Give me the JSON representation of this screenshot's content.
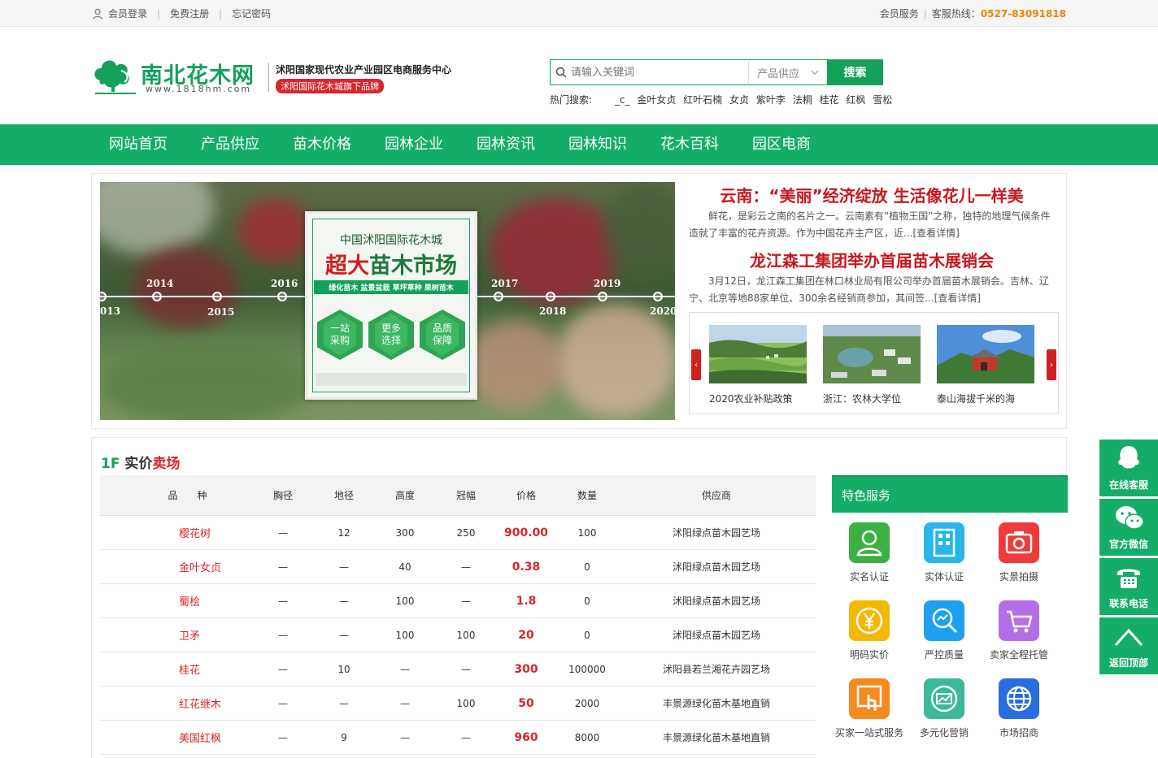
{
  "topbar": {
    "login": "会员登录",
    "register": "免费注册",
    "forgot": "忘记密码",
    "member_service": "会员服务",
    "hotline_label": "客服热线：",
    "hotline": "0527-83091818"
  },
  "header": {
    "logo_name": "南北花木网",
    "logo_url": "www.1818hm.com",
    "slogan_line1": "沭阳国家现代农业产业园区电商服务中心",
    "slogan_line2": "沭阳国际花木城旗下品牌"
  },
  "search": {
    "placeholder": "请输入关键词",
    "category": "产品供应",
    "button": "搜索",
    "hot_label": "热门搜索:",
    "hot_terms": [
      "_c_",
      "金叶女贞",
      "红叶石楠",
      "女贞",
      "紫叶李",
      "法桐",
      "桂花",
      "红枫",
      "雪松"
    ]
  },
  "nav": {
    "items": [
      "网站首页",
      "产品供应",
      "苗木价格",
      "园林企业",
      "园林资讯",
      "园林知识",
      "花木百科",
      "园区电商"
    ]
  },
  "banner": {
    "years": [
      "2014",
      "2016",
      "013",
      "2015",
      "2017",
      "2019",
      "2018",
      "2020"
    ],
    "poster_title": "中国沭阳国际花木城",
    "poster_big_red": "超大",
    "poster_big_green": "苗木市场",
    "poster_tags": "绿化苗木 盆景盆栽 草坪草种 果树苗木",
    "hex1": "一站采购",
    "hex2": "更多选择",
    "hex3": "品质保障"
  },
  "news": [
    {
      "title": "云南：“美丽”经济绽放 生活像花儿一样美",
      "summary": "鲜花，是彩云之南的名片之一。云南素有“植物王国”之称，独特的地理气候条件造就了丰富的花卉资源。作为中国花卉主产区，近...[查看详情]"
    },
    {
      "title": "龙江森工集团举办首届苗木展销会",
      "summary": "3月12日，龙江森工集团在林口林业局有限公司举办首届苗木展销会。吉林、辽宁、北京等地88家单位、300余名经销商参加，其间签...[查看详情]"
    }
  ],
  "thumbs": [
    {
      "caption": "2020农业补贴政策"
    },
    {
      "caption": "浙江：农林大学位"
    },
    {
      "caption": "泰山海拔千米的海"
    }
  ],
  "floor": {
    "num": "1F",
    "title_a": "实价",
    "title_b": "卖场",
    "headers": [
      "品　　种",
      "胸径",
      "地径",
      "高度",
      "冠幅",
      "价格",
      "数量",
      "供应商"
    ],
    "rows": [
      {
        "name": "樱花树",
        "xj": "—",
        "dj": "12",
        "gd": "300",
        "gf": "250",
        "price": "900.00",
        "qty": "100",
        "supplier": "沭阳绿点苗木园艺场"
      },
      {
        "name": "金叶女贞",
        "xj": "—",
        "dj": "—",
        "gd": "40",
        "gf": "—",
        "price": "0.38",
        "qty": "0",
        "supplier": "沭阳绿点苗木园艺场"
      },
      {
        "name": "蜀桧",
        "xj": "—",
        "dj": "—",
        "gd": "100",
        "gf": "—",
        "price": "1.8",
        "qty": "0",
        "supplier": "沭阳绿点苗木园艺场"
      },
      {
        "name": "卫矛",
        "xj": "—",
        "dj": "—",
        "gd": "100",
        "gf": "100",
        "price": "20",
        "qty": "0",
        "supplier": "沭阳绿点苗木园艺场"
      },
      {
        "name": "桂花",
        "xj": "—",
        "dj": "10",
        "gd": "—",
        "gf": "—",
        "price": "300",
        "qty": "100000",
        "supplier": "沭阳县若兰湘花卉园艺场"
      },
      {
        "name": "红花继木",
        "xj": "—",
        "dj": "—",
        "gd": "—",
        "gf": "100",
        "price": "50",
        "qty": "2000",
        "supplier": "丰景源绿化苗木基地直销"
      },
      {
        "name": "美国红枫",
        "xj": "—",
        "dj": "9",
        "gd": "—",
        "gf": "—",
        "price": "960",
        "qty": "8000",
        "supplier": "丰景源绿化苗木基地直销"
      }
    ]
  },
  "service": {
    "title": "特色服务",
    "items": [
      {
        "label": "实名认证",
        "icon": "person-icon",
        "color": "#3cb043"
      },
      {
        "label": "实体认证",
        "icon": "building-icon",
        "color": "#29b6e8"
      },
      {
        "label": "实景拍摄",
        "icon": "camera-icon",
        "color": "#ee3b3b"
      },
      {
        "label": "明码实价",
        "icon": "yen-icon",
        "color": "#f5b800"
      },
      {
        "label": "严控质量",
        "icon": "magnifier-icon",
        "color": "#1ea0ee"
      },
      {
        "label": "卖家全程托管",
        "icon": "cart-icon",
        "color": "#b56ee8"
      },
      {
        "label": "买家一站式服务",
        "icon": "hand-icon",
        "color": "#f58a1f"
      },
      {
        "label": "多元化营销",
        "icon": "chart-icon",
        "color": "#3cb89a"
      },
      {
        "label": "市场招商",
        "icon": "globe-icon",
        "color": "#2a6de0"
      }
    ]
  },
  "sidefloat": {
    "items": [
      "在线客服",
      "官方微信",
      "联系电话",
      "返回顶部"
    ]
  }
}
